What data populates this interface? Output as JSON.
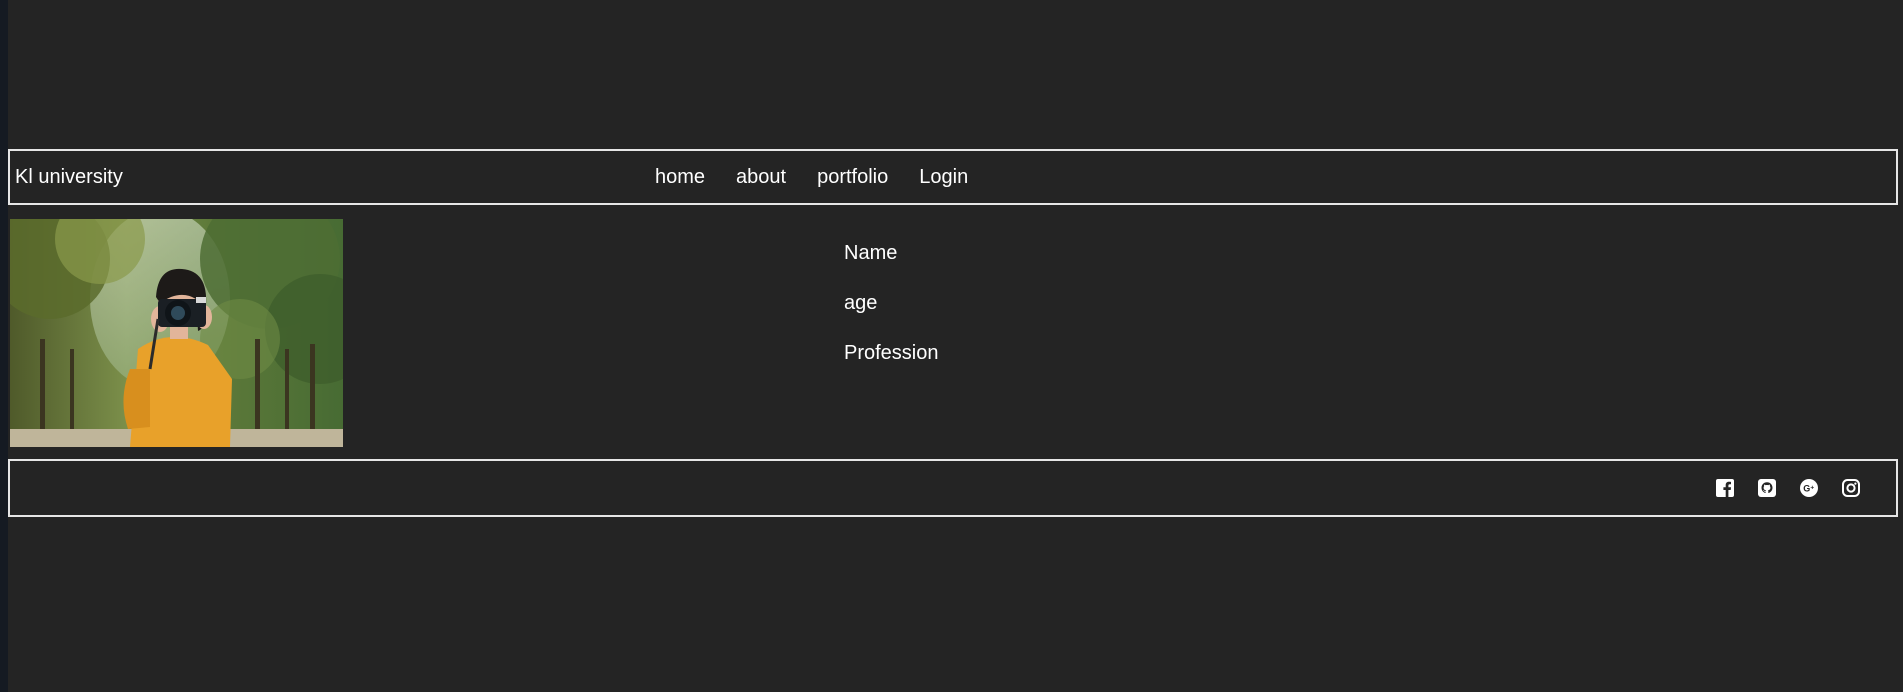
{
  "header": {
    "brand": "Kl university",
    "nav": [
      "home",
      "about",
      "portfolio",
      "Login"
    ]
  },
  "profile": {
    "fields": [
      "Name",
      "age",
      "Profession"
    ]
  },
  "footer": {
    "social_icons": [
      "facebook-icon",
      "github-icon",
      "google-plus-icon",
      "instagram-icon"
    ]
  },
  "colors": {
    "background": "#242424",
    "text": "#ffffff",
    "border": "#e6e6e6"
  }
}
